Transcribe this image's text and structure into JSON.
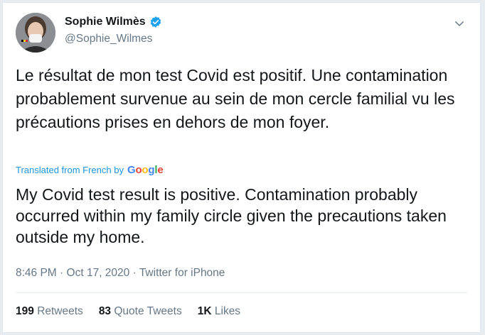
{
  "author": {
    "name": "Sophie Wilmès",
    "handle": "@Sophie_Wilmes"
  },
  "tweet": {
    "original_text": "Le résultat de mon test Covid est positif. Une contamination probablement survenue au sein de mon cercle familial vu les précautions prises en dehors de mon foyer.",
    "translated_from": "Translated from French by",
    "translator_brand": "Google",
    "translation": "My Covid test result is positive. Contamination probably occurred within my family circle given the precautions taken outside my home."
  },
  "meta": {
    "time": "8:46 PM",
    "separator": "·",
    "date": "Oct 17, 2020",
    "source": "Twitter for iPhone"
  },
  "stats": {
    "retweets": {
      "count": "199",
      "label": "Retweets"
    },
    "quotes": {
      "count": "83",
      "label": "Quote Tweets"
    },
    "likes": {
      "count": "1K",
      "label": "Likes"
    }
  },
  "colors": {
    "verified": "#1da1f2",
    "link": "#1b95e0",
    "text": "#14171a",
    "muted": "#657786"
  }
}
